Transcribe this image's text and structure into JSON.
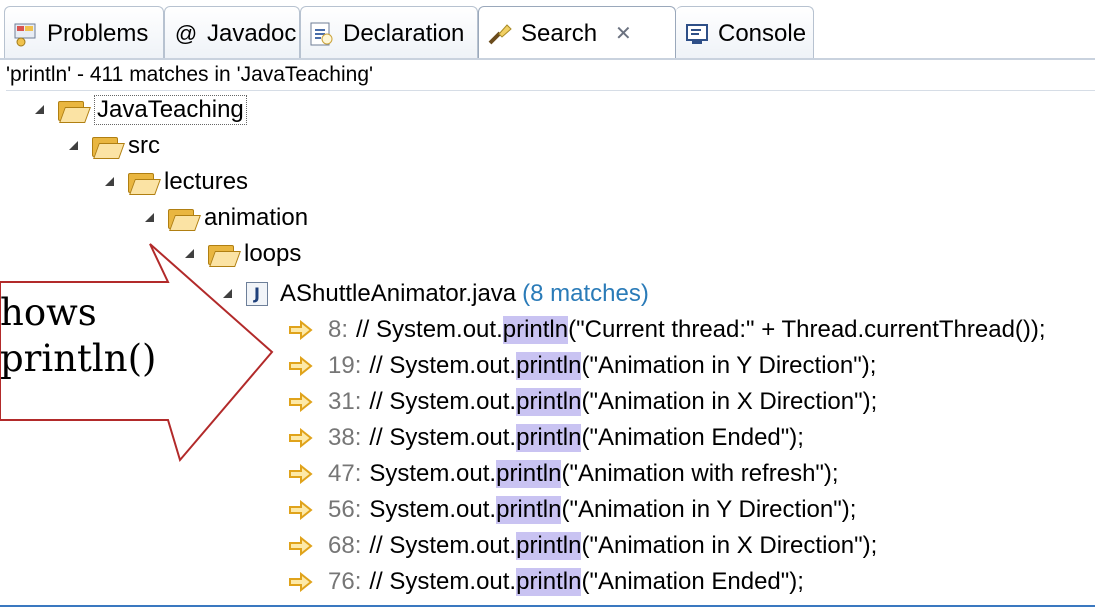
{
  "tabs": [
    {
      "label": "Problems",
      "icon": "problems-icon"
    },
    {
      "label": "Javadoc",
      "icon": "at-icon"
    },
    {
      "label": "Declaration",
      "icon": "declaration-icon"
    },
    {
      "label": "Search",
      "icon": "search-icon",
      "active": true,
      "close": "✕"
    },
    {
      "label": "Console",
      "icon": "console-icon"
    }
  ],
  "status": "'println' - 411 matches in 'JavaTeaching'",
  "tree": {
    "project": "JavaTeaching",
    "src": "src",
    "lectures": "lectures",
    "animation": "animation",
    "loops": "loops",
    "file": "AShuttleAnimator.java",
    "file_matches": "(8 matches)",
    "results": [
      {
        "line": "8:",
        "before": "// System.out.",
        "match": "println",
        "after": " (\"Current thread:\" + Thread.currentThread());"
      },
      {
        "line": "19:",
        "before": "//  System.out.",
        "match": "println",
        "after": "(\"Animation in Y Direction\");"
      },
      {
        "line": "31:",
        "before": "// System.out.",
        "match": "println",
        "after": "(\"Animation in X Direction\");"
      },
      {
        "line": "38:",
        "before": "// System.out.",
        "match": "println",
        "after": "(\"Animation Ended\");"
      },
      {
        "line": "47:",
        "before": "System.out.",
        "match": "println",
        "after": "(\"Animation with refresh\");"
      },
      {
        "line": "56:",
        "before": "System.out.",
        "match": "println",
        "after": "(\"Animation in Y Direction\");"
      },
      {
        "line": "68:",
        "before": "// System.out.",
        "match": "println",
        "after": "(\"Animation in X Direction\");"
      },
      {
        "line": "76:",
        "before": "// System.out.",
        "match": "println",
        "after": "(\"Animation Ended\");"
      }
    ]
  },
  "callout": {
    "line1": "hows",
    "line2": "println()"
  },
  "colors": {
    "highlight": "#c9c3f2",
    "matches": "#2a7bb8",
    "callout_border": "#b22a2a",
    "arrow_icon": "#f2b01e"
  }
}
